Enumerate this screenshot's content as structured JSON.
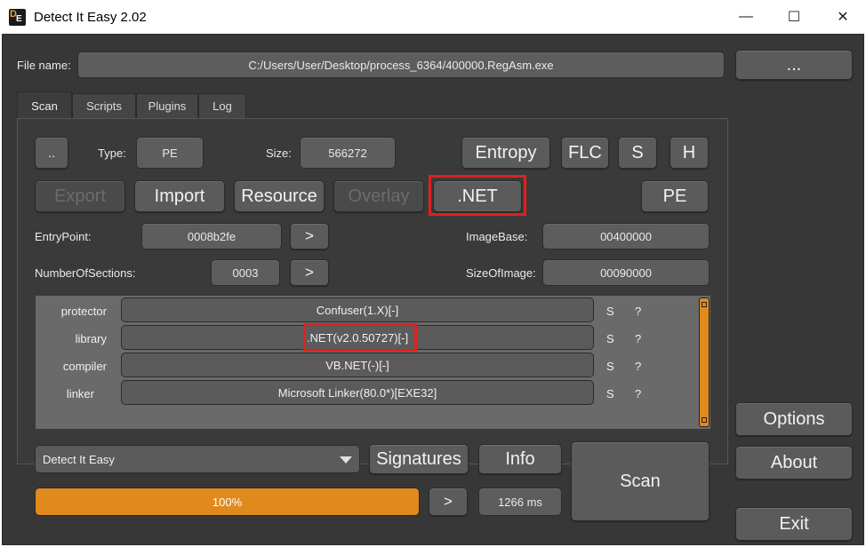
{
  "window": {
    "title": "Detect It Easy 2.02",
    "icon": "die-app-icon",
    "controls": {
      "minimize": "—",
      "maximize": "☐",
      "close": "✕"
    }
  },
  "file": {
    "label": "File name:",
    "path": "C:/Users/User/Desktop/process_6364/400000.RegAsm.exe",
    "browse_label": "..."
  },
  "tabs": [
    {
      "label": "Scan",
      "active": true
    },
    {
      "label": "Scripts",
      "active": false
    },
    {
      "label": "Plugins",
      "active": false
    },
    {
      "label": "Log",
      "active": false
    }
  ],
  "info": {
    "dotdot_label": "..",
    "type_label": "Type:",
    "type_value": "PE",
    "size_label": "Size:",
    "size_value": "566272",
    "entropy_label": "Entropy",
    "flc_label": "FLC",
    "s_label": "S",
    "h_label": "H",
    "export_label": "Export",
    "import_label": "Import",
    "resource_label": "Resource",
    "overlay_label": "Overlay",
    "net_label": ".NET",
    "pe_label": "PE",
    "entrypoint_label": "EntryPoint:",
    "entrypoint_value": "0008b2fe",
    "sections_label": "NumberOfSections:",
    "sections_value": "0003",
    "imagebase_label": "ImageBase:",
    "imagebase_value": "00400000",
    "sizeofimage_label": "SizeOfImage:",
    "sizeofimage_value": "00090000",
    "arrow_label": ">"
  },
  "results": [
    {
      "type": "protector",
      "name": "Confuser(1.X)[-]",
      "s": "S",
      "q": "?"
    },
    {
      "type": "library",
      "name": ".NET(v2.0.50727)[-]",
      "s": "S",
      "q": "?"
    },
    {
      "type": "compiler",
      "name": "VB.NET(-)[-]",
      "s": "S",
      "q": "?"
    },
    {
      "type": "linker",
      "name": "Microsoft Linker(80.0*)[EXE32]",
      "s": "S",
      "q": "?"
    }
  ],
  "bottom": {
    "database_value": "Detect It Easy",
    "signatures_label": "Signatures",
    "info_label": "Info",
    "scan_label": "Scan",
    "progress_text": "100%",
    "progress_fraction": 1.0,
    "next_label": ">",
    "time_value": "1266 ms"
  },
  "side": {
    "options_label": "Options",
    "about_label": "About",
    "exit_label": "Exit"
  },
  "colors": {
    "accent_orange": "#e08a1e",
    "highlight_red": "#e02020",
    "panel_bg": "#373737",
    "button_bg": "#5b5b5b"
  }
}
